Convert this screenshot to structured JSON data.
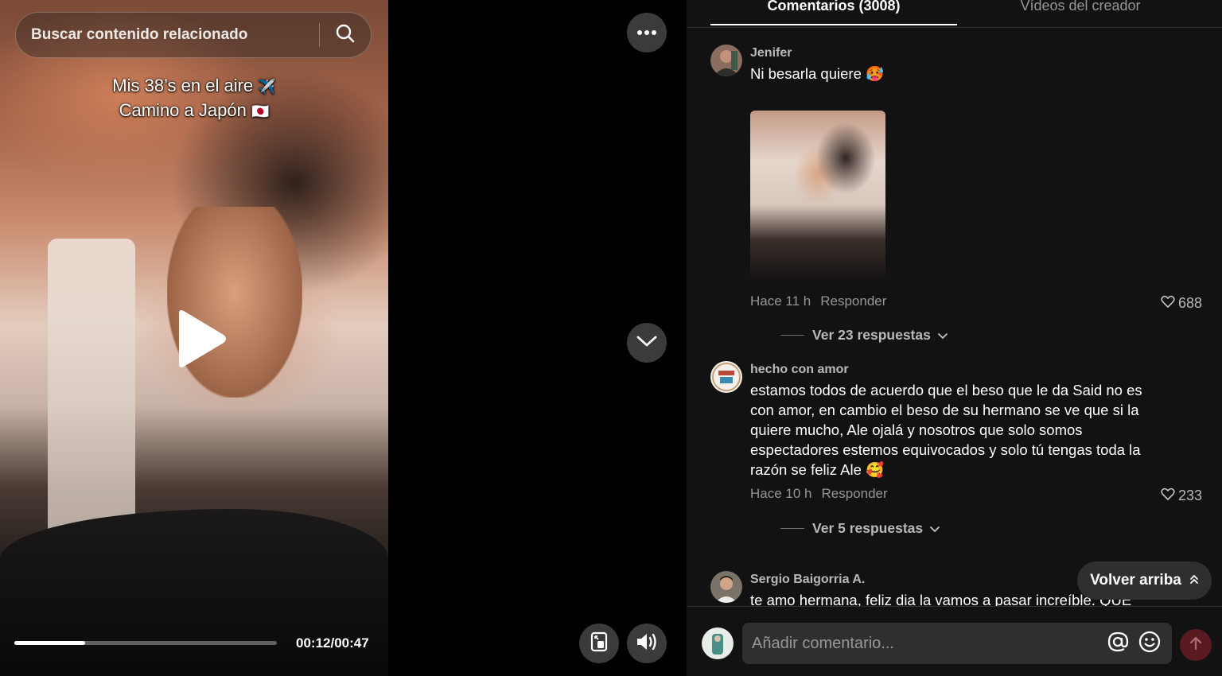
{
  "search": {
    "placeholder": "Buscar contenido relacionado"
  },
  "video": {
    "caption_line1": "Mis 38’s en el aire",
    "caption_line1_emoji": "✈️",
    "caption_line2": "Camino a Japón",
    "caption_line2_emoji": "🇯🇵",
    "time": "00:12/00:47",
    "progress_fraction": 0.27
  },
  "tabs": {
    "comments": "Comentarios (3008)",
    "creator_videos": "Vídeos del creador"
  },
  "comments": [
    {
      "user": "Jenifer",
      "text": "Ni besarla quiere 🥵",
      "time": "Hace 11 h",
      "reply": "Responder",
      "likes": "688",
      "view_replies": "Ver 23 respuestas"
    },
    {
      "user": "hecho con amor",
      "text": "estamos todos de acuerdo que el beso que le da Said no es con amor, en cambio el beso de su hermano se ve que si la quiere mucho, Ale ojalá y nosotros que solo somos espectadores estemos equivocados y solo tú tengas toda la razón se feliz Ale 🥰",
      "time": "Hace 10 h",
      "reply": "Responder",
      "likes": "233",
      "view_replies": "Ver 5 respuestas"
    },
    {
      "user": "Sergio Baigorria A.",
      "text": "te amo hermana, feliz dia la vamos a pasar increíble. QUE"
    }
  ],
  "back_to_top": "Volver arriba",
  "comment_input": {
    "placeholder": "Añadir comentario..."
  },
  "colors": {
    "panel_bg": "#121212",
    "input_bg": "#2f2f2f",
    "send_disabled": "#5a1a22"
  },
  "icons": [
    "search-icon",
    "more-icon",
    "play-icon",
    "chevron-down-icon",
    "pip-icon",
    "volume-icon",
    "heart-icon",
    "double-chevron-up-icon",
    "at-icon",
    "emoji-icon",
    "arrow-up-icon"
  ]
}
